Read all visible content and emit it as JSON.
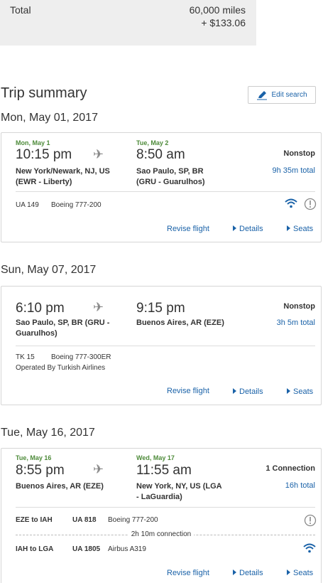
{
  "summary": {
    "total_label": "Total",
    "miles": "60,000 miles",
    "cash": "+ $133.06"
  },
  "trip": {
    "title": "Trip summary",
    "edit_label": "Edit search"
  },
  "links": {
    "revise": "Revise flight",
    "details": "Details",
    "seats": "Seats"
  },
  "flights": [
    {
      "day": "Mon, May 01, 2017",
      "dep_date": "Mon, May 1",
      "dep_time": "10:15 pm",
      "dep_city": "New York/Newark, NJ, US",
      "dep_airport": "(EWR - Liberty)",
      "arr_date": "Tue, May 2",
      "arr_time": "8:50 am",
      "arr_city": "Sao Paulo, SP, BR",
      "arr_airport": "(GRU - Guarulhos)",
      "stops": "Nonstop",
      "duration": "9h 35m total",
      "flight_number": "UA 149",
      "aircraft": "Boeing 777-200"
    },
    {
      "day": "Sun, May 07, 2017",
      "dep_time": "6:10 pm",
      "dep_city": "Sao Paulo, SP, BR (GRU -",
      "dep_airport": "Guarulhos)",
      "arr_time": "9:15 pm",
      "arr_city": "Buenos Aires, AR (EZE)",
      "stops": "Nonstop",
      "duration": "3h 5m total",
      "flight_number": "TK 15",
      "aircraft": "Boeing 777-300ER",
      "operated_by": "Operated By Turkish Airlines"
    },
    {
      "day": "Tue, May 16, 2017",
      "dep_date": "Tue, May 16",
      "dep_time": "8:55 pm",
      "dep_city": "Buenos Aires, AR (EZE)",
      "arr_date": "Wed, May 17",
      "arr_time": "11:55 am",
      "arr_city": "New York, NY, US (LGA",
      "arr_airport": "- LaGuardia)",
      "stops": "1 Connection",
      "duration": "16h total",
      "segments": [
        {
          "route": "EZE to IAH",
          "flight_number": "UA 818",
          "aircraft": "Boeing 777-200"
        },
        {
          "route": "IAH to LGA",
          "flight_number": "UA 1805",
          "aircraft": "Airbus A319"
        }
      ],
      "connection": "2h 10m connection"
    }
  ],
  "icons": {
    "plane": "✈",
    "accent": "#1a62a8",
    "date_green": "#4e8b3a"
  }
}
